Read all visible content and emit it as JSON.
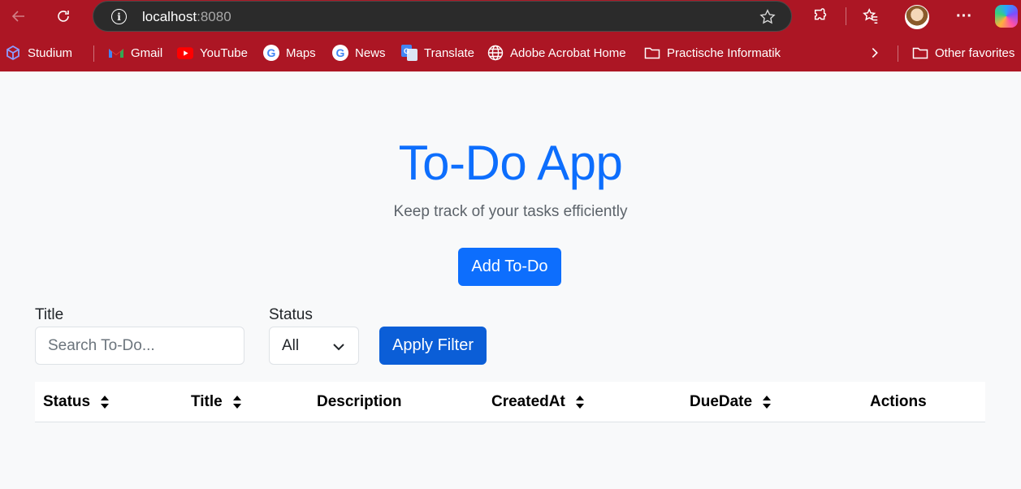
{
  "browser": {
    "url_host": "localhost",
    "url_port": ":8080",
    "favorites": [
      {
        "label": "Studium",
        "icon": "cube-icon"
      },
      {
        "label": "Gmail",
        "icon": "gmail-icon"
      },
      {
        "label": "YouTube",
        "icon": "youtube-icon"
      },
      {
        "label": "Maps",
        "icon": "google-icon"
      },
      {
        "label": "News",
        "icon": "google-icon"
      },
      {
        "label": "Translate",
        "icon": "translate-icon"
      },
      {
        "label": "Adobe Acrobat Home",
        "icon": "globe-icon"
      },
      {
        "label": "Practische Informatik",
        "icon": "folder-icon"
      }
    ],
    "other_favorites": "Other favorites",
    "colors": {
      "chrome": "#ac1624",
      "address_bar": "#2b2b2b"
    }
  },
  "app": {
    "title": "To-Do App",
    "subtitle": "Keep track of your tasks efficiently",
    "add_button": "Add To-Do",
    "filter": {
      "title_label": "Title",
      "title_placeholder": "Search To-Do...",
      "status_label": "Status",
      "status_value": "All",
      "apply_button": "Apply Filter"
    },
    "table": {
      "columns": [
        {
          "label": "Status",
          "sortable": true
        },
        {
          "label": "Title",
          "sortable": true
        },
        {
          "label": "Description",
          "sortable": false
        },
        {
          "label": "CreatedAt",
          "sortable": true
        },
        {
          "label": "DueDate",
          "sortable": true
        },
        {
          "label": "Actions",
          "sortable": false
        }
      ]
    },
    "colors": {
      "primary": "#0d6efd",
      "background": "#f8f9fa"
    }
  }
}
